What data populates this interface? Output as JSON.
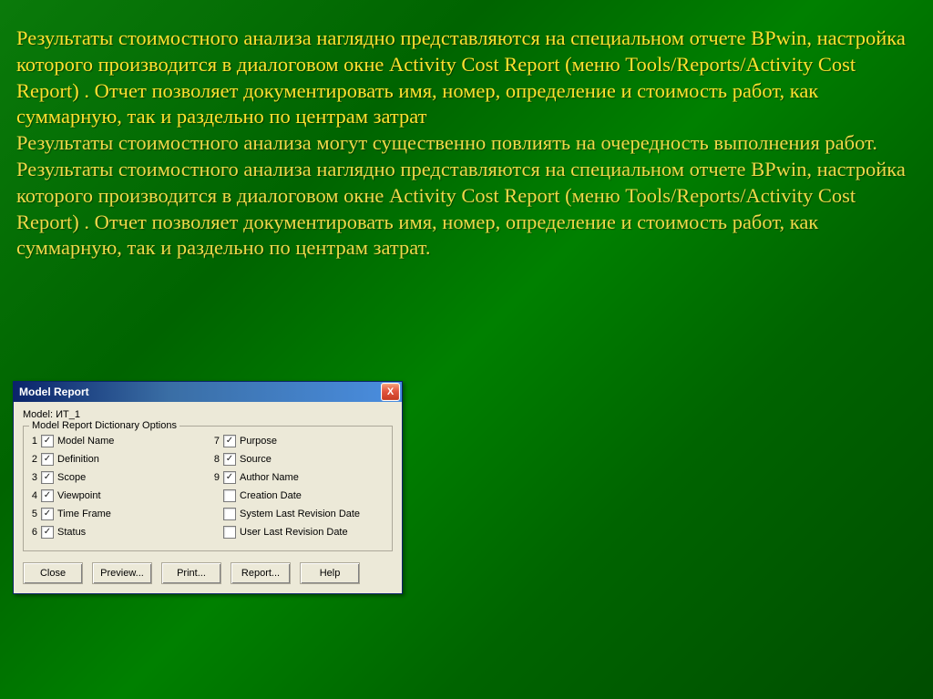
{
  "slide": {
    "p1": "Результаты стоимостного анализа наглядно представляются на специальном отчете BPwin, настройка которого производится в диалоговом окне Activity Cost Report (меню Tools/Reports/Activity Cost Report) . Отчет позволяет документировать имя, номер, определение и стоимость работ, как суммарную, так и раздельно по центрам затрат",
    "p2": "Результаты стоимостного анализа могут существенно повлиять на очередность выполнения работ. Результаты стоимостного анализа наглядно представляются на специальном отчете BPwin, настройка которого производится в диалоговом окне Activity Cost Report (меню Tools/Reports/Activity Cost Report) . Отчет позволяет документировать имя, номер, определение и стоимость работ, как суммарную, так и раздельно по центрам затрат."
  },
  "dialog": {
    "title": "Model Report",
    "close": "X",
    "model_label": "Model:",
    "model_value": "ИТ_1",
    "group_label": "Model Report Dictionary Options",
    "options_left": [
      {
        "n": "1",
        "label": "Model Name",
        "checked": true
      },
      {
        "n": "2",
        "label": "Definition",
        "checked": true
      },
      {
        "n": "3",
        "label": "Scope",
        "checked": true
      },
      {
        "n": "4",
        "label": "Viewpoint",
        "checked": true
      },
      {
        "n": "5",
        "label": "Time Frame",
        "checked": true
      },
      {
        "n": "6",
        "label": "Status",
        "checked": true
      }
    ],
    "options_right": [
      {
        "n": "7",
        "label": "Purpose",
        "checked": true
      },
      {
        "n": "8",
        "label": "Source",
        "checked": true
      },
      {
        "n": "9",
        "label": "Author Name",
        "checked": true
      },
      {
        "n": "",
        "label": "Creation Date",
        "checked": false
      },
      {
        "n": "",
        "label": "System Last Revision Date",
        "checked": false
      },
      {
        "n": "",
        "label": "User Last Revision Date",
        "checked": false
      }
    ],
    "buttons": {
      "close": "Close",
      "preview": "Preview...",
      "print": "Print...",
      "report": "Report...",
      "help": "Help"
    }
  }
}
